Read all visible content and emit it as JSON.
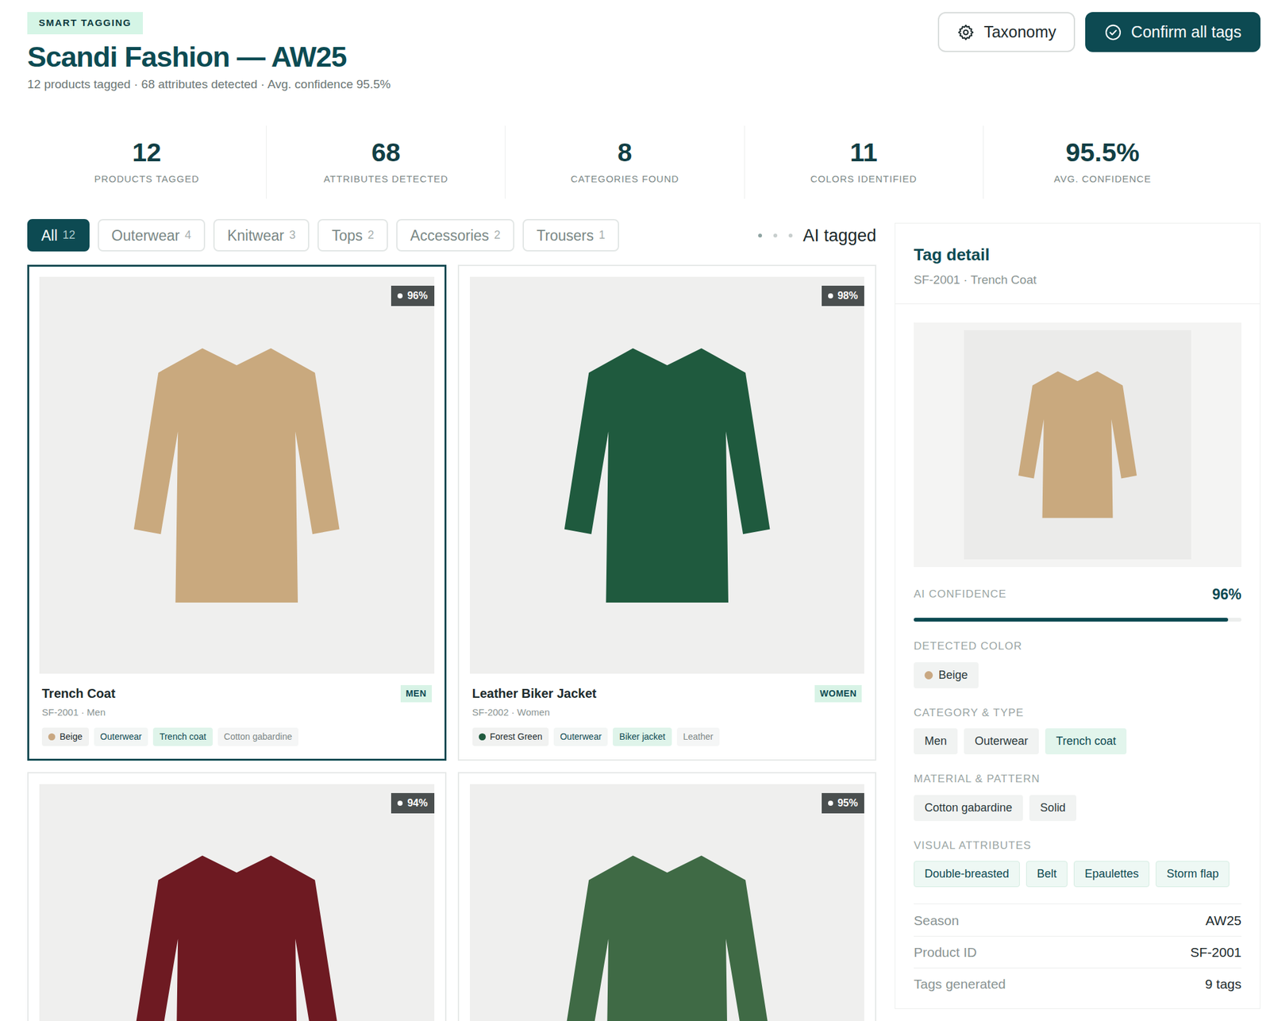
{
  "header": {
    "badge": "SMART TAGGING",
    "title": "Scandi Fashion — AW25",
    "subtitle": "12 products tagged · 68 attributes detected · Avg. confidence 95.5%"
  },
  "actions": [
    {
      "label": "Taxonomy",
      "kind": "secondary"
    },
    {
      "label": "Confirm all tags",
      "kind": "primary"
    }
  ],
  "stats": [
    {
      "value": "12",
      "label": "PRODUCTS TAGGED"
    },
    {
      "value": "68",
      "label": "ATTRIBUTES DETECTED"
    },
    {
      "value": "8",
      "label": "CATEGORIES FOUND"
    },
    {
      "value": "11",
      "label": "COLORS IDENTIFIED"
    },
    {
      "value": "95.5%",
      "label": "AVG. CONFIDENCE"
    }
  ],
  "filters": [
    {
      "label": "All",
      "count": "12",
      "selected": true
    },
    {
      "label": "Outerwear",
      "count": "4",
      "selected": false
    },
    {
      "label": "Knitwear",
      "count": "3",
      "selected": false
    },
    {
      "label": "Tops",
      "count": "2",
      "selected": false
    },
    {
      "label": "Accessories",
      "count": "2",
      "selected": false
    },
    {
      "label": "Trousers",
      "count": "1",
      "selected": false
    }
  ],
  "legend": {
    "label": "AI tagged"
  },
  "products": [
    {
      "name": "Trench Coat",
      "code": "SF-2001 · Men",
      "gender": "MEN",
      "confidence": "96%",
      "selected": true,
      "color": "#c9a97e",
      "tags": [
        {
          "label": "Beige",
          "kind": "color",
          "color": "#c9a882"
        },
        {
          "label": "Outerwear",
          "kind": "category"
        },
        {
          "label": "Trench coat",
          "kind": "type"
        },
        {
          "label": "Cotton gabardine",
          "kind": "material"
        }
      ]
    },
    {
      "name": "Leather Biker Jacket",
      "code": "SF-2002 · Women",
      "gender": "WOMEN",
      "confidence": "98%",
      "selected": false,
      "color": "#1f5a3e",
      "tags": [
        {
          "label": "Forest Green",
          "kind": "color",
          "color": "#1f5a3e"
        },
        {
          "label": "Outerwear",
          "kind": "category"
        },
        {
          "label": "Biker jacket",
          "kind": "type"
        },
        {
          "label": "Leather",
          "kind": "material"
        }
      ]
    },
    {
      "confidence": "94%",
      "selected": false,
      "color": "#6e1a22",
      "tags": []
    },
    {
      "confidence": "95%",
      "selected": false,
      "color": "#3f6a45",
      "tags": []
    }
  ],
  "detail": {
    "title": "Tag detail",
    "subtitle": "SF-2001 · Trench Coat",
    "color": "#c9a97e",
    "confidence": {
      "label": "AI CONFIDENCE",
      "reading": "96%",
      "level": 0.96
    },
    "sections": [
      {
        "label": "DETECTED COLOR",
        "chips": [
          {
            "label": "Beige",
            "kind": "color",
            "color": "#c9a882"
          }
        ]
      },
      {
        "label": "CATEGORY & TYPE",
        "chips": [
          {
            "label": "Men",
            "kind": "plain"
          },
          {
            "label": "Outerwear",
            "kind": "plain"
          },
          {
            "label": "Trench coat",
            "kind": "accent"
          }
        ]
      },
      {
        "label": "MATERIAL & PATTERN",
        "chips": [
          {
            "label": "Cotton gabardine",
            "kind": "plain"
          },
          {
            "label": "Solid",
            "kind": "plain"
          }
        ]
      },
      {
        "label": "VISUAL ATTRIBUTES",
        "chips": [
          {
            "label": "Double-breasted",
            "kind": "outline"
          },
          {
            "label": "Belt",
            "kind": "outline"
          },
          {
            "label": "Epaulettes",
            "kind": "outline"
          },
          {
            "label": "Storm flap",
            "kind": "outline"
          }
        ]
      }
    ],
    "facts": [
      {
        "label": "Season",
        "value": "AW25"
      },
      {
        "label": "Product ID",
        "value": "SF-2001"
      },
      {
        "label": "Tags generated",
        "value": "9 tags"
      }
    ]
  }
}
